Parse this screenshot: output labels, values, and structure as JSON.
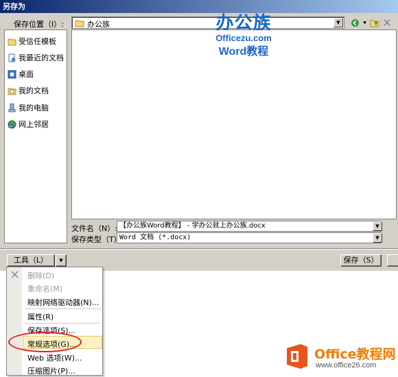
{
  "window": {
    "title": "另存为"
  },
  "save_in": {
    "label": "保存位置（I）:",
    "value": "办公族"
  },
  "places": [
    {
      "label": "受信任模板",
      "icon": "folder-icon"
    },
    {
      "label": "我最近的文档",
      "icon": "recent-documents-icon"
    },
    {
      "label": "桌面",
      "icon": "desktop-icon"
    },
    {
      "label": "我的文档",
      "icon": "my-documents-icon"
    },
    {
      "label": "我的电脑",
      "icon": "my-computer-icon"
    },
    {
      "label": "网上邻居",
      "icon": "network-places-icon"
    }
  ],
  "file_name": {
    "label": "文件名（N）:",
    "value": "【办公族Word教程】 - 学办公就上办公族.docx"
  },
  "save_type": {
    "label": "保存类型（T）:",
    "value": "Word 文档 (*.docx)"
  },
  "buttons": {
    "tools": "工具（L）",
    "save": "保存（S）"
  },
  "tools_menu": {
    "items": [
      {
        "label": "删除(D)",
        "enabled": false
      },
      {
        "label": "重命名(M)",
        "enabled": false
      },
      {
        "label": "映射网络驱动器(N)...",
        "enabled": true
      },
      {
        "label": "属性(R)",
        "enabled": true
      },
      {
        "label": "保存选项(S)...",
        "enabled": true
      },
      {
        "label": "常规选项(G)...",
        "enabled": true,
        "highlighted": true
      },
      {
        "label": "Web 选项(W)...",
        "enabled": true
      },
      {
        "label": "压缩图片(P)...",
        "enabled": true
      }
    ]
  },
  "watermark": {
    "logo_text": "办公族",
    "url": "Officezu.com",
    "tagline": "Word教程"
  },
  "brand": {
    "name": "Office教程网",
    "url": "www.office26.com"
  },
  "colors": {
    "title_bar": "#0a246a",
    "logo_blue": "#1c68c7",
    "brand_orange": "#f07d00",
    "highlight_ellipse": "#e02020"
  }
}
